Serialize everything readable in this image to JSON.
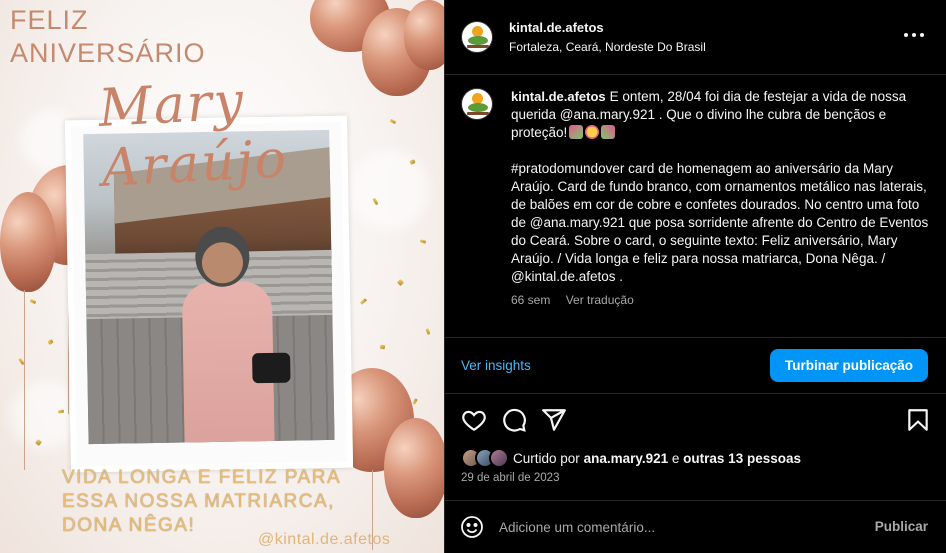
{
  "image": {
    "card_title": [
      "FELIZ",
      "ANIVERSÁRIO"
    ],
    "card_name": "Mary Araújo",
    "card_message": [
      "VIDA LONGA E FELIZ PARA",
      "ESSA NOSSA MATRIARCA,",
      "DONA NÊGA!"
    ],
    "card_handle": "@kintal.de.afetos"
  },
  "header": {
    "username": "kintal.de.afetos",
    "location": "Fortaleza, Ceará, Nordeste Do Brasil",
    "more_icon": "more-horizontal-icon"
  },
  "caption": {
    "username": "kintal.de.afetos",
    "text_1": "E ontem, 28/04 foi dia de festejar a vida de nossa querida @ana.mary.921 . Que o divino lhe cubra de bençãos e proteção!",
    "text_2": "#pratodomundover card de homenagem ao aniversário da Mary Araújo. Card de fundo branco, com ornamentos metálico nas laterais, de balões em cor de cobre e confetes dourados. No centro uma foto de @ana.mary.921 que posa sorridente afrente do Centro de Eventos do Ceará. Sobre o card, o seguinte texto: Feliz aniversário, Mary Araújo. / Vida longa e feliz para nossa matriarca, Dona Nêga. / @kintal.de.afetos .",
    "time_ago": "66 sem",
    "see_translation": "Ver tradução"
  },
  "insights": {
    "view_insights": "Ver insights",
    "boost_post": "Turbinar publicação",
    "boost_color": "#0095f6"
  },
  "actions": [
    "heart-icon",
    "comment-icon",
    "share-icon",
    "bookmark-icon"
  ],
  "likes": {
    "prefix": "Curtido por",
    "user": "ana.mary.921",
    "middle": "e",
    "others": "outras 13 pessoas"
  },
  "date": "29 de abril de 2023",
  "comment": {
    "placeholder": "Adicione um comentário...",
    "publish": "Publicar"
  }
}
